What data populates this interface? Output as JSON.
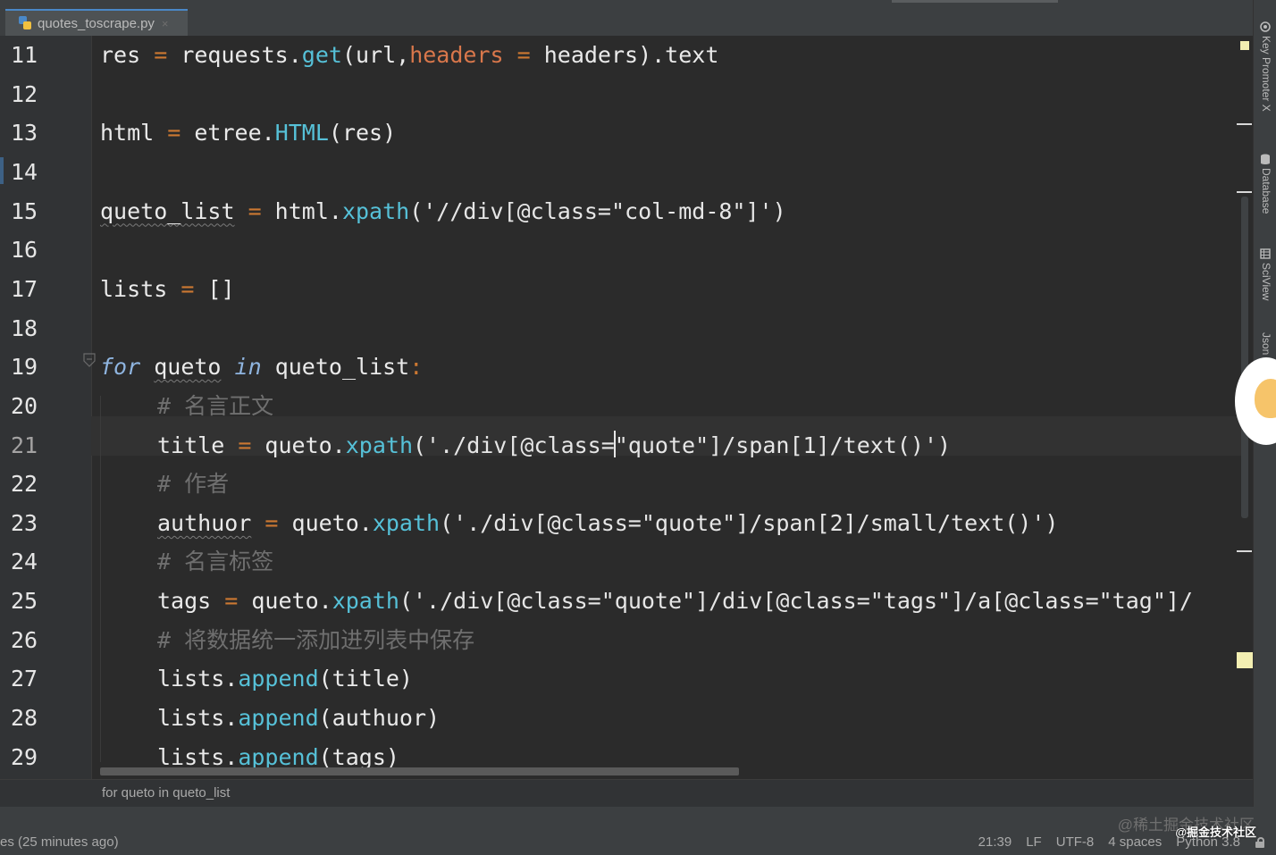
{
  "tab": {
    "filename": "quotes_toscrape.py",
    "close": "×"
  },
  "lines": [
    {
      "num": "11",
      "indent": false,
      "tokens": [
        {
          "t": "res",
          "c": ""
        },
        {
          "t": " = ",
          "c": "op"
        },
        {
          "t": "requests.",
          "c": ""
        },
        {
          "t": "get",
          "c": "fn"
        },
        {
          "t": "(url,",
          "c": ""
        },
        {
          "t": "headers",
          "c": "param"
        },
        {
          "t": " = ",
          "c": "op"
        },
        {
          "t": "headers).text",
          "c": ""
        }
      ]
    },
    {
      "num": "12",
      "indent": false,
      "tokens": []
    },
    {
      "num": "13",
      "indent": false,
      "tokens": [
        {
          "t": "html",
          "c": ""
        },
        {
          "t": " = ",
          "c": "op"
        },
        {
          "t": "etree.",
          "c": ""
        },
        {
          "t": "HTML",
          "c": "fn"
        },
        {
          "t": "(res)",
          "c": ""
        }
      ]
    },
    {
      "num": "14",
      "indent": false,
      "tokens": []
    },
    {
      "num": "15",
      "indent": false,
      "tokens": [
        {
          "t": "queto_list",
          "c": "wavy"
        },
        {
          "t": " = ",
          "c": "op"
        },
        {
          "t": "html.",
          "c": ""
        },
        {
          "t": "xpath",
          "c": "fn"
        },
        {
          "t": "('//div[@class=\"col-md-8\"]')",
          "c": "str"
        }
      ]
    },
    {
      "num": "16",
      "indent": false,
      "tokens": []
    },
    {
      "num": "17",
      "indent": false,
      "tokens": [
        {
          "t": "lists",
          "c": ""
        },
        {
          "t": " = ",
          "c": "op"
        },
        {
          "t": "[]",
          "c": ""
        }
      ]
    },
    {
      "num": "18",
      "indent": false,
      "tokens": []
    },
    {
      "num": "19",
      "indent": false,
      "tokens": [
        {
          "t": "for",
          "c": "kwp"
        },
        {
          "t": " ",
          "c": ""
        },
        {
          "t": "queto",
          "c": "wavy"
        },
        {
          "t": " ",
          "c": ""
        },
        {
          "t": "in",
          "c": "kwp"
        },
        {
          "t": " queto_list",
          "c": ""
        },
        {
          "t": ":",
          "c": "op"
        }
      ]
    },
    {
      "num": "20",
      "indent": true,
      "tokens": [
        {
          "t": "# 名言正文",
          "c": "cm"
        }
      ]
    },
    {
      "num": "21",
      "indent": true,
      "current": true,
      "tokens": [
        {
          "t": "title",
          "c": ""
        },
        {
          "t": " = ",
          "c": "op"
        },
        {
          "t": "queto.",
          "c": ""
        },
        {
          "t": "xpath",
          "c": "fn"
        },
        {
          "t": "('./div[@class=",
          "c": "str"
        },
        {
          "t": "",
          "c": "caret"
        },
        {
          "t": "\"quote\"]/span[1]/text()')",
          "c": "str"
        }
      ]
    },
    {
      "num": "22",
      "indent": true,
      "tokens": [
        {
          "t": "# 作者",
          "c": "cm"
        }
      ]
    },
    {
      "num": "23",
      "indent": true,
      "tokens": [
        {
          "t": "authuor",
          "c": "wavy"
        },
        {
          "t": " = ",
          "c": "op"
        },
        {
          "t": "queto.",
          "c": ""
        },
        {
          "t": "xpath",
          "c": "fn"
        },
        {
          "t": "('./div[@class=\"quote\"]/span[2]/small/text()')",
          "c": "str"
        }
      ]
    },
    {
      "num": "24",
      "indent": true,
      "tokens": [
        {
          "t": "# 名言标签",
          "c": "cm"
        }
      ]
    },
    {
      "num": "25",
      "indent": true,
      "tokens": [
        {
          "t": "tags",
          "c": ""
        },
        {
          "t": " = ",
          "c": "op"
        },
        {
          "t": "queto.",
          "c": ""
        },
        {
          "t": "xpath",
          "c": "fn"
        },
        {
          "t": "('./div[@class=\"quote\"]/div[@class=\"tags\"]/a[@class=\"tag\"]/",
          "c": "str"
        }
      ]
    },
    {
      "num": "26",
      "indent": true,
      "tokens": [
        {
          "t": "# 将数据统一添加进列表中保存",
          "c": "cm"
        }
      ]
    },
    {
      "num": "27",
      "indent": true,
      "tokens": [
        {
          "t": "lists.",
          "c": ""
        },
        {
          "t": "append",
          "c": "fn"
        },
        {
          "t": "(title)",
          "c": ""
        }
      ]
    },
    {
      "num": "28",
      "indent": true,
      "tokens": [
        {
          "t": "lists.",
          "c": ""
        },
        {
          "t": "append",
          "c": "fn"
        },
        {
          "t": "(authuor)",
          "c": ""
        }
      ]
    },
    {
      "num": "29",
      "indent": true,
      "tokens": [
        {
          "t": "lists.",
          "c": ""
        },
        {
          "t": "append",
          "c": "fn"
        },
        {
          "t": "(tags)",
          "c": ""
        }
      ]
    }
  ],
  "breadcrumb": {
    "text": "for queto in queto_list"
  },
  "status": {
    "left": "es (25 minutes ago)",
    "position": "21:39",
    "line_sep": "LF",
    "encoding": "UTF-8",
    "indent": "4 spaces",
    "interpreter": "Python 3.8",
    "watermark": "@稀土掘金技术社区",
    "watermark2": "@掘金技术社区"
  },
  "right_tools": {
    "key_promoter": "Key Promoter X",
    "database": "Database",
    "sciview": "SciView",
    "json": "Json P"
  },
  "colors": {
    "keyword": "#8fb5e0",
    "function": "#56c1d8",
    "parameter": "#d9774b",
    "operator": "#cc7832",
    "comment": "#6f6f6f",
    "background": "#2b2b2b"
  }
}
